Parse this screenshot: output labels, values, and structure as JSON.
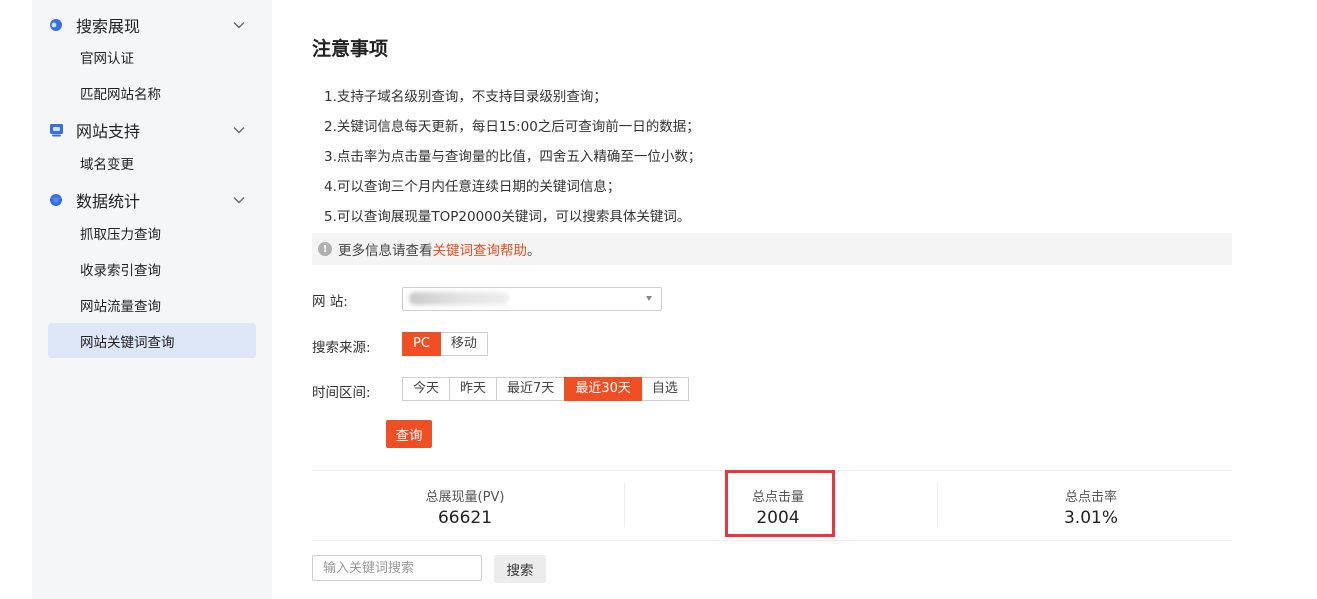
{
  "sidebar": {
    "groups": [
      {
        "title": "搜索展现",
        "items": [
          "官网认证",
          "匹配网站名称"
        ]
      },
      {
        "title": "网站支持",
        "items": [
          "域名变更"
        ]
      },
      {
        "title": "数据统计",
        "items": [
          "抓取压力查询",
          "收录索引查询",
          "网站流量查询",
          "网站关键词查询"
        ]
      }
    ],
    "active_item": "网站关键词查询"
  },
  "main": {
    "title": "注意事项",
    "notes": [
      "1.支持子域名级别查询，不支持目录级别查询；",
      "2.关键词信息每天更新，每日15:00之后可查询前一日的数据；",
      "3.点击率为点击量与查询量的比值，四舍五入精确至一位小数；",
      "4.可以查询三个月内任意连续日期的关键词信息；",
      "5.可以查询展现量TOP20000关键词，可以搜索具体关键词。"
    ],
    "info": {
      "prefix": "更多信息请查看",
      "link": "关键词查询帮助",
      "suffix": "。"
    }
  },
  "form": {
    "site_label": "网 站:",
    "source_label": "搜索来源:",
    "source_options": [
      "PC",
      "移动"
    ],
    "source_selected": "PC",
    "range_label": "时间区间:",
    "range_options": [
      "今天",
      "昨天",
      "最近7天",
      "最近30天",
      "自选"
    ],
    "range_selected": "最近30天",
    "query_button": "查询"
  },
  "stats": [
    {
      "label": "总展现量(PV)",
      "value": "66621"
    },
    {
      "label": "总点击量",
      "value": "2004"
    },
    {
      "label": "总点击率",
      "value": "3.01%"
    }
  ],
  "keyword_search": {
    "placeholder": "输入关键词搜索",
    "button": "搜索"
  },
  "colors": {
    "accent": "#f04e24",
    "highlight_box": "#e8363a",
    "sidebar_bg": "#f5f6f8",
    "active_item_bg": "#dde7f7"
  }
}
